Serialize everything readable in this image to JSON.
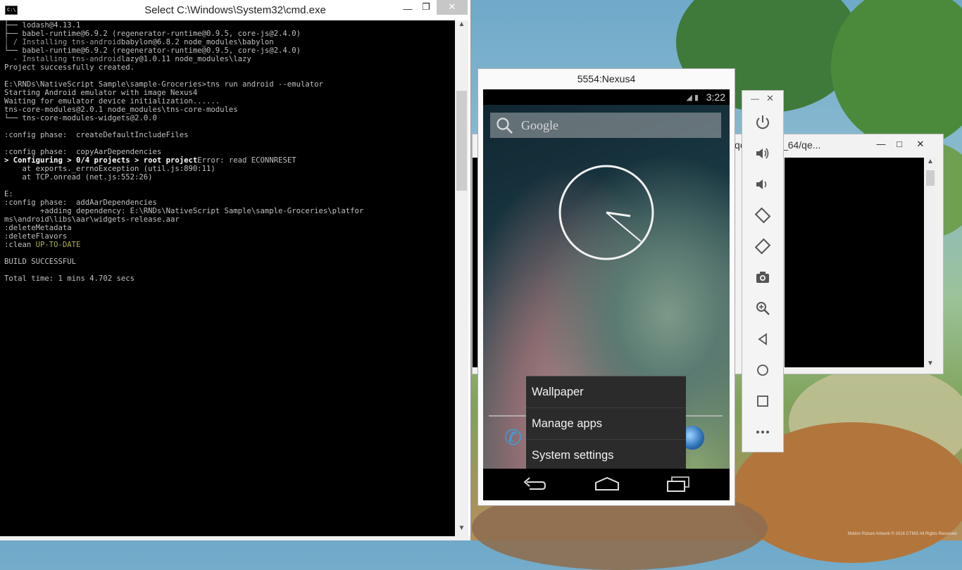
{
  "cmd": {
    "title": "Select C:\\Windows\\System32\\cmd.exe",
    "icon": "C:\\",
    "controls": {
      "minimize": "—",
      "restore": "❐",
      "close": "✕"
    },
    "lines": [
      {
        "segs": [
          {
            "t": "├── lodash@4.13.1",
            "c": ""
          }
        ]
      },
      {
        "segs": [
          {
            "t": "├── babel-runtime@6.9.2 (regenerator-runtime@0.9.5, core-js@2.4.0)",
            "c": ""
          }
        ]
      },
      {
        "segs": [
          {
            "t": "│ / Installing tns-android",
            "c": "c-dim"
          },
          {
            "t": "babylon@6.8.2 node_modules\\babylon",
            "c": ""
          }
        ]
      },
      {
        "segs": [
          {
            "t": "└── babel-runtime@6.9.2 (regenerator-runtime@0.9.5, core-js@2.4.0)",
            "c": ""
          }
        ]
      },
      {
        "segs": [
          {
            "t": "  - Installing tns-android",
            "c": "c-dim"
          },
          {
            "t": "lazy@1.0.11 node_modules\\lazy",
            "c": ""
          }
        ]
      },
      {
        "segs": [
          {
            "t": "Project successfully created.",
            "c": ""
          }
        ]
      },
      {
        "segs": [
          {
            "t": "",
            "c": ""
          }
        ]
      },
      {
        "segs": [
          {
            "t": "E:\\RNDs\\NativeScript Sample\\sample-Groceries>tns run android --emulator",
            "c": ""
          }
        ]
      },
      {
        "segs": [
          {
            "t": "Starting Android emulator with image Nexus4",
            "c": ""
          }
        ]
      },
      {
        "segs": [
          {
            "t": "Waiting for emulator device initialization......",
            "c": ""
          }
        ]
      },
      {
        "segs": [
          {
            "t": "tns-core-modules@2.0.1 node_modules\\tns-core-modules",
            "c": ""
          }
        ]
      },
      {
        "segs": [
          {
            "t": "└── tns-core-modules-widgets@2.0.0",
            "c": ""
          }
        ]
      },
      {
        "segs": [
          {
            "t": "",
            "c": ""
          }
        ]
      },
      {
        "segs": [
          {
            "t": ":config phase:  createDefaultIncludeFiles",
            "c": ""
          }
        ]
      },
      {
        "segs": [
          {
            "t": "",
            "c": ""
          }
        ]
      },
      {
        "segs": [
          {
            "t": ":config phase:  copyAarDependencies",
            "c": ""
          }
        ]
      },
      {
        "segs": [
          {
            "t": "> Configuring > 0/4 projects > root project",
            "c": "c-bold"
          },
          {
            "t": "Error: read ECONNRESET",
            "c": ""
          }
        ]
      },
      {
        "segs": [
          {
            "t": "    at exports._errnoException (util.js:890:11)",
            "c": ""
          }
        ]
      },
      {
        "segs": [
          {
            "t": "    at TCP.onread (net.js:552:26)",
            "c": ""
          }
        ]
      },
      {
        "segs": [
          {
            "t": "",
            "c": ""
          }
        ]
      },
      {
        "segs": [
          {
            "t": "E:",
            "c": ""
          }
        ]
      },
      {
        "segs": [
          {
            "t": ":config phase:  addAarDependencies",
            "c": ""
          }
        ]
      },
      {
        "segs": [
          {
            "t": "        +adding dependency: E:\\RNDs\\NativeScript Sample\\sample-Groceries\\platfor",
            "c": ""
          }
        ]
      },
      {
        "segs": [
          {
            "t": "ms\\android\\libs\\aar\\widgets-release.aar",
            "c": ""
          }
        ]
      },
      {
        "segs": [
          {
            "t": ":deleteMetadata",
            "c": ""
          }
        ]
      },
      {
        "segs": [
          {
            "t": ":deleteFlavors",
            "c": ""
          }
        ]
      },
      {
        "segs": [
          {
            "t": ":clean ",
            "c": ""
          },
          {
            "t": "UP-TO-DATE",
            "c": "c-yel"
          }
        ]
      },
      {
        "segs": [
          {
            "t": "",
            "c": ""
          }
        ]
      },
      {
        "segs": [
          {
            "t": "BUILD SUCCESSFUL",
            "c": ""
          }
        ]
      },
      {
        "segs": [
          {
            "t": "",
            "c": ""
          }
        ]
      },
      {
        "segs": [
          {
            "t": "Total time: 1 mins 4.702 secs",
            "c": ""
          }
        ]
      }
    ]
  },
  "qemu": {
    "title": "dows-x86_64/qe...",
    "left_fragment": "q"
  },
  "emulator": {
    "title": "5554:Nexus4",
    "status_time": "3:22",
    "search_placeholder": "Google",
    "menu": [
      "Wallpaper",
      "Manage apps",
      "System settings"
    ]
  },
  "toolbar": {
    "minimize": "—",
    "close": "✕",
    "buttons": [
      "power-icon",
      "volume-up-icon",
      "volume-down-icon",
      "rotate-left-icon",
      "rotate-right-icon",
      "camera-icon",
      "zoom-icon",
      "back-icon",
      "home-icon",
      "overview-icon",
      "more-icon"
    ]
  },
  "desktop": {
    "credit": "Motion Picture Artwork © 2016 CTMG All Rights Reserved."
  },
  "colors": {
    "console_bg": "#000000",
    "console_text": "#c0c0c0",
    "menu_bg": "#2b2b2b",
    "accent_blue": "#38a0e0"
  }
}
